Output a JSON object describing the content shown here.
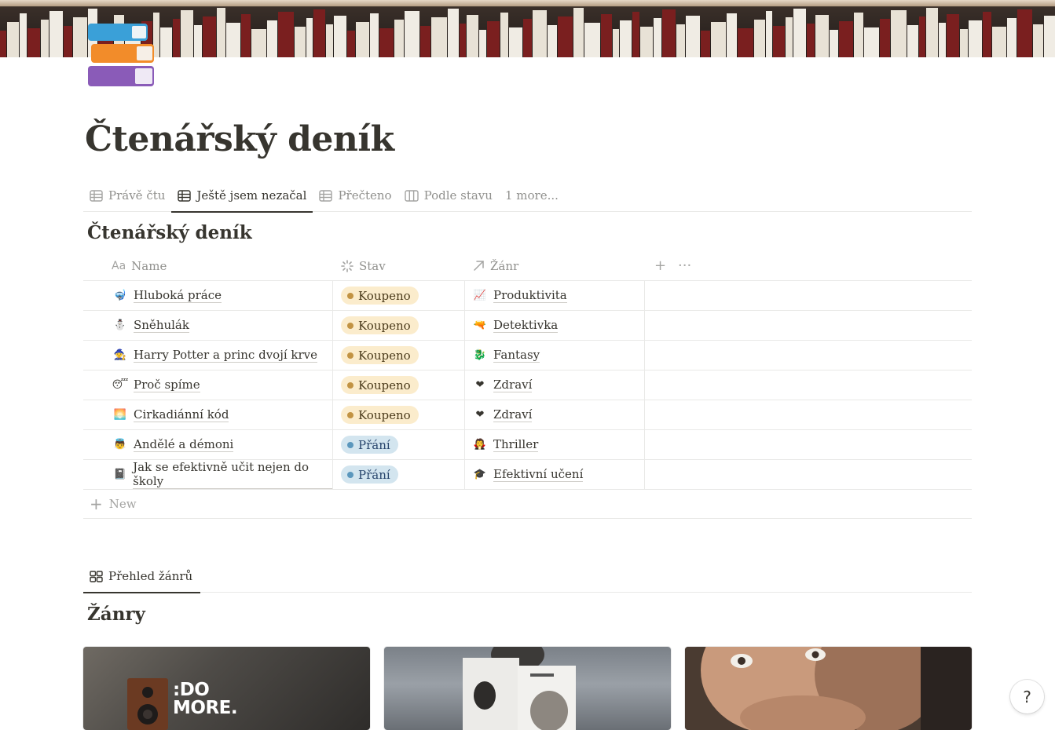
{
  "page": {
    "title": "Čtenářský deník",
    "icon": "books-icon"
  },
  "views": {
    "tabs": [
      {
        "label": "Právě čtu",
        "icon": "table-icon",
        "active": false
      },
      {
        "label": "Ještě jsem nezačal",
        "icon": "table-icon",
        "active": true
      },
      {
        "label": "Přečteno",
        "icon": "table-icon",
        "active": false
      },
      {
        "label": "Podle stavu",
        "icon": "board-icon",
        "active": false
      },
      {
        "label": "1 more...",
        "icon": "",
        "active": false
      }
    ]
  },
  "database": {
    "title": "Čtenářský deník",
    "columns": [
      {
        "label": "Name",
        "icon": "text-icon"
      },
      {
        "label": "Stav",
        "icon": "status-icon"
      },
      {
        "label": "Žánr",
        "icon": "relation-arrow-icon"
      }
    ],
    "add_column": "+",
    "more": "···",
    "rows": [
      {
        "emoji": "🤿",
        "name": "Hluboká práce",
        "status": "Koupeno",
        "status_type": "bought",
        "genre_emoji": "📈",
        "genre": "Produktivita"
      },
      {
        "emoji": "⛄",
        "name": "Sněhulák",
        "status": "Koupeno",
        "status_type": "bought",
        "genre_emoji": "🔫",
        "genre": "Detektivka"
      },
      {
        "emoji": "🧙",
        "name": "Harry Potter a princ dvojí krve",
        "status": "Koupeno",
        "status_type": "bought",
        "genre_emoji": "🐉",
        "genre": "Fantasy"
      },
      {
        "emoji": "😴",
        "name": "Proč spíme",
        "status": "Koupeno",
        "status_type": "bought",
        "genre_emoji": "❤",
        "genre": "Zdraví"
      },
      {
        "emoji": "🌅",
        "name": "Cirkadiánní kód",
        "status": "Koupeno",
        "status_type": "bought",
        "genre_emoji": "❤",
        "genre": "Zdraví"
      },
      {
        "emoji": "👼",
        "name": "Andělé a démoni",
        "status": "Přání",
        "status_type": "wish",
        "genre_emoji": "🧛",
        "genre": "Thriller"
      },
      {
        "emoji": "📓",
        "name": "Jak se efektivně učit nejen do školy",
        "status": "Přání",
        "status_type": "wish",
        "genre_emoji": "🎓",
        "genre": "Efektivní učení"
      }
    ],
    "new_label": "New"
  },
  "genres_section": {
    "tab_label": "Přehled žánrů",
    "tab_icon": "gallery-icon",
    "title": "Žánry",
    "card1_text_line1": ":DO",
    "card1_text_line2": "MORE."
  },
  "help": "?",
  "colors": {
    "text": "#37352f",
    "muted": "#91918e",
    "border": "#e9e9e7",
    "bought_bg": "#fbeccc",
    "bought_dot": "#c29343",
    "wish_bg": "#d3e5ef",
    "wish_dot": "#5b97bd"
  }
}
